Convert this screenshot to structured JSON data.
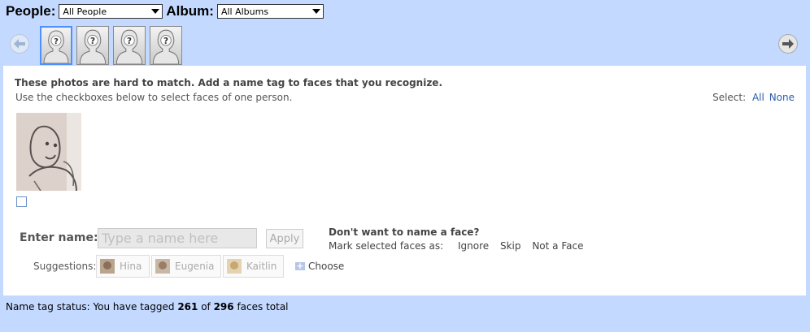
{
  "toolbar": {
    "people_label": "People:",
    "people_value": "All People",
    "album_label": "Album:",
    "album_value": "All Albums"
  },
  "carousel": {
    "prev_icon": "arrow-left-icon",
    "next_icon": "arrow-right-icon",
    "faces": [
      "?",
      "?",
      "?",
      "?"
    ],
    "active_index": 0
  },
  "panel": {
    "title": "These photos are hard to match. Add a name tag to faces that you recognize.",
    "subtitle": "Use the checkboxes below to select faces of one person.",
    "select_label": "Select:",
    "select_all": "All",
    "select_none": "None"
  },
  "naming": {
    "enter_label": "Enter name:",
    "input_placeholder": "Type a name here",
    "apply_label": "Apply",
    "dont_want_title": "Don't want to name a face?",
    "mark_label": "Mark selected faces as:",
    "ignore": "Ignore",
    "skip": "Skip",
    "not_a_face": "Not a Face",
    "suggestions_label": "Suggestions:",
    "suggestions": [
      "Hina",
      "Eugenia",
      "Kaitlin"
    ],
    "choose_label": "Choose"
  },
  "status": {
    "prefix": "Name tag status:  You have tagged ",
    "tagged": "261",
    "of": " of ",
    "total": "296",
    "suffix": " faces total"
  },
  "colors": {
    "background": "#c3d9ff",
    "accent": "#4d90fe",
    "link": "#2a5db0"
  }
}
